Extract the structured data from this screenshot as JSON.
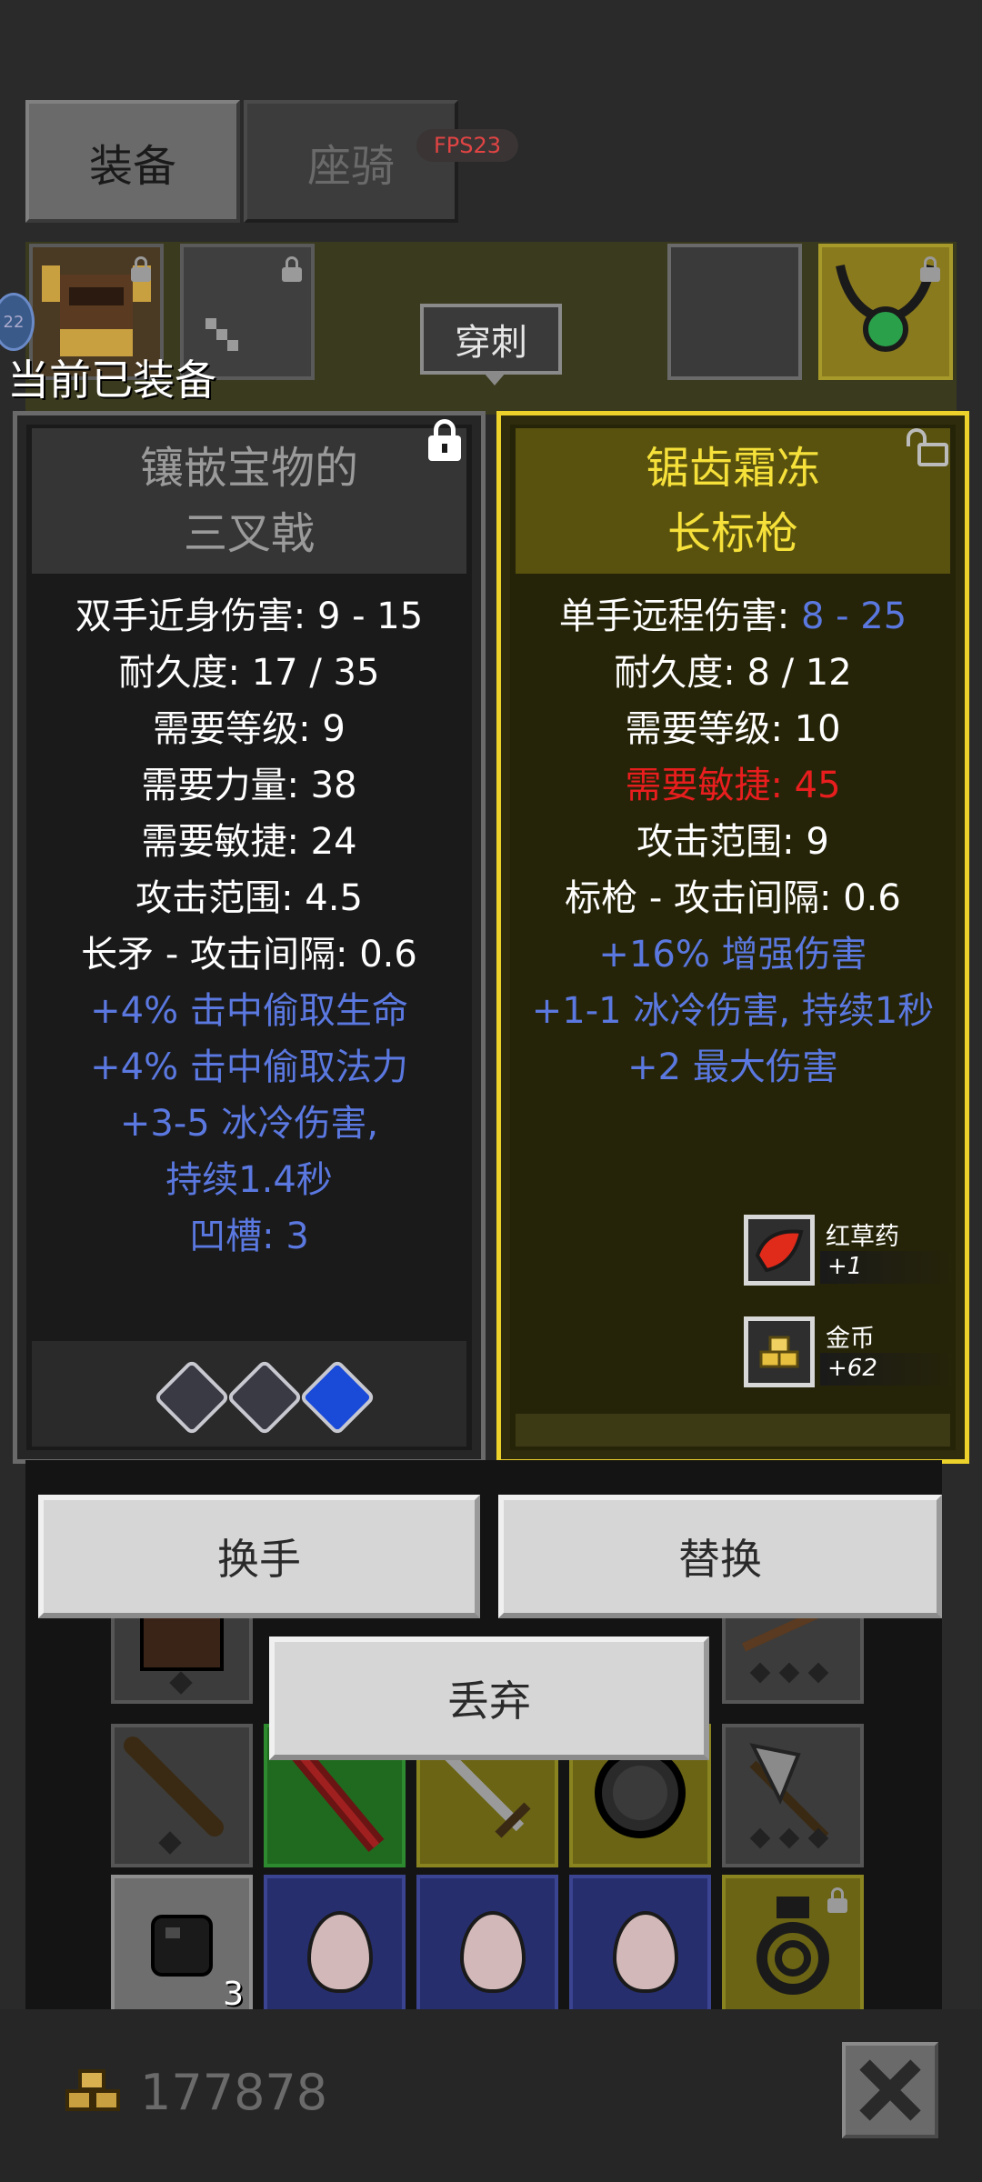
{
  "tabs": [
    {
      "label": "装备",
      "active": true
    },
    {
      "label": "座骑",
      "active": false
    }
  ],
  "fps_badge": "FPS23",
  "skill_tag": "穿刺",
  "level_bubble": "22",
  "equipped_label": "当前已装备",
  "equipped_item": {
    "name_line1": "镶嵌宝物的",
    "name_line2": "三叉戟",
    "locked": true,
    "stats": [
      "双手近身伤害: 9 - 15",
      "耐久度: 17 / 35",
      "需要等级: 9",
      "需要力量: 38",
      "需要敏捷: 24",
      "攻击范围: 4.5",
      "长矛 - 攻击间隔: 0.6"
    ],
    "magic_stats": [
      "+4% 击中偷取生命",
      "+4% 击中偷取法力",
      "+3-5 冰冷伤害,",
      "持续1.4秒",
      "凹槽: 3"
    ],
    "socket_gems": [
      "silver-gem-icon",
      "silver-gem-icon",
      "blue-gem-icon"
    ]
  },
  "compare_item": {
    "name_line1": "锯齿霜冻",
    "name_line2": "长标枪",
    "locked": false,
    "damage_label": "单手远程伤害: ",
    "damage_value": "8 - 25",
    "stats_a": [
      "耐久度: 8 / 12",
      "需要等级: 10"
    ],
    "requirement_unmet": "需要敏捷: 45",
    "stats_b": [
      "攻击范围: 9",
      "标枪 - 攻击间隔: 0.6"
    ],
    "magic_stats": [
      "+16% 增强伤害",
      "+1-1 冰冷伤害, 持续1秒",
      "+2 最大伤害"
    ]
  },
  "loot_notifications": [
    {
      "name": "红草药",
      "amount": "+1",
      "icon": "red-herb-icon"
    },
    {
      "name": "金币",
      "amount": "+62",
      "icon": "gold-coins-icon"
    }
  ],
  "actions": {
    "swap_hands": "换手",
    "replace": "替换",
    "drop": "丢弃"
  },
  "inventory": {
    "rows": [
      [
        "armor",
        "",
        "",
        "",
        "crossbow"
      ],
      [
        "club",
        "red-sword",
        "short-sword",
        "round-shield",
        "battle-axe"
      ],
      [
        "ore",
        "egg",
        "egg",
        "egg",
        "amulet"
      ]
    ],
    "ore_count": "3"
  },
  "gold_amount": "177878",
  "colors": {
    "rare_yellow": "#f6e03a",
    "magic_blue": "#5a78e0",
    "requirement_red": "#e81e1e"
  }
}
